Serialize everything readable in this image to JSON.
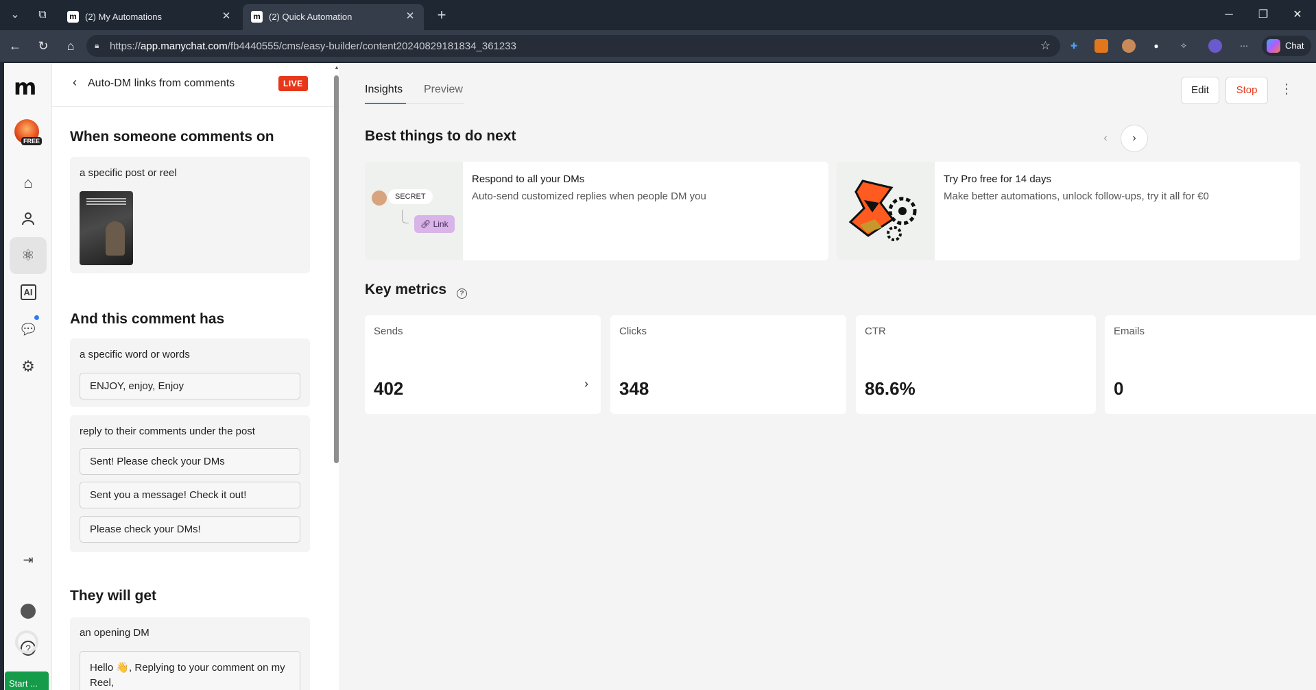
{
  "browser": {
    "tabs": [
      {
        "title": "(2) My Automations"
      },
      {
        "title": "(2) Quick Automation"
      }
    ],
    "url_prefix": "https://",
    "url_host": "app.manychat.com",
    "url_path": "/fb4440555/cms/easy-builder/content20240829181834_361233",
    "chat_label": "Chat"
  },
  "rail": {
    "badge": "FREE",
    "start_label": "Start ..."
  },
  "panel": {
    "back_title": "Auto-DM links from comments",
    "status": "LIVE",
    "trigger": {
      "heading": "When someone comments on",
      "target": "a specific post or reel"
    },
    "condition": {
      "heading": "And this comment has",
      "rule": "a specific word or words",
      "keywords": "ENJOY, enjoy, Enjoy",
      "reply_label": "reply to their comments under the post",
      "replies": [
        "Sent! Please check your DMs",
        "Sent you a message! Check it out!",
        "Please check your DMs!"
      ]
    },
    "result": {
      "heading": "They will get",
      "dm_label": "an opening DM",
      "dm_text": "Hello 👋, Replying to your comment on my Reel,"
    }
  },
  "main": {
    "tabs": [
      "Insights",
      "Preview"
    ],
    "actions": {
      "edit": "Edit",
      "stop": "Stop"
    },
    "next_heading": "Best things to do next",
    "tips": [
      {
        "title": "Respond to all your DMs",
        "desc": "Auto-send customized replies when people DM you",
        "chip1": "SECRET",
        "chip2": "Link"
      },
      {
        "title": "Try Pro free for 14 days",
        "desc": "Make better automations, unlock follow-ups, try it all for €0"
      }
    ],
    "metrics_heading": "Key metrics",
    "metrics": [
      {
        "label": "Sends",
        "value": "402"
      },
      {
        "label": "Clicks",
        "value": "348"
      },
      {
        "label": "CTR",
        "value": "86.6%"
      },
      {
        "label": "Emails",
        "value": "0"
      }
    ]
  },
  "colors": {
    "accent": "#2f7bf6",
    "live": "#e8381b",
    "stop": "#e8381b",
    "start": "#149c4a"
  }
}
